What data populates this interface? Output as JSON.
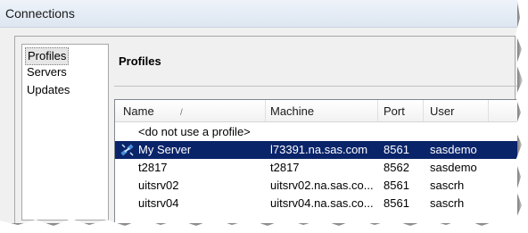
{
  "window": {
    "title": "Connections"
  },
  "nav": {
    "items": [
      "Profiles",
      "Servers",
      "Updates"
    ],
    "selected": "Profiles"
  },
  "panel": {
    "title": "Profiles"
  },
  "table": {
    "headers": [
      "Name",
      "Machine",
      "Port",
      "User"
    ],
    "sort_indicator": "/",
    "rows": [
      {
        "name": "<do not use a profile>",
        "machine": "",
        "port": "",
        "user": ""
      },
      {
        "name": "My Server",
        "machine": "l73391.na.sas.com",
        "port": "8561",
        "user": "sasdemo",
        "selected": true,
        "icon": "server-connection-icon"
      },
      {
        "name": "t2817",
        "machine": "t2817",
        "port": "8562",
        "user": "sasdemo"
      },
      {
        "name": "uitsrv02",
        "machine": "uitsrv02.na.sas.co...",
        "port": "8561",
        "user": "sascrh"
      },
      {
        "name": "uitsrv04",
        "machine": "uitsrv04.na.sas.co...",
        "port": "8561",
        "user": "sascrh"
      }
    ]
  },
  "colors": {
    "selection": "#0a246a",
    "title_bar": "#dde6f1"
  }
}
